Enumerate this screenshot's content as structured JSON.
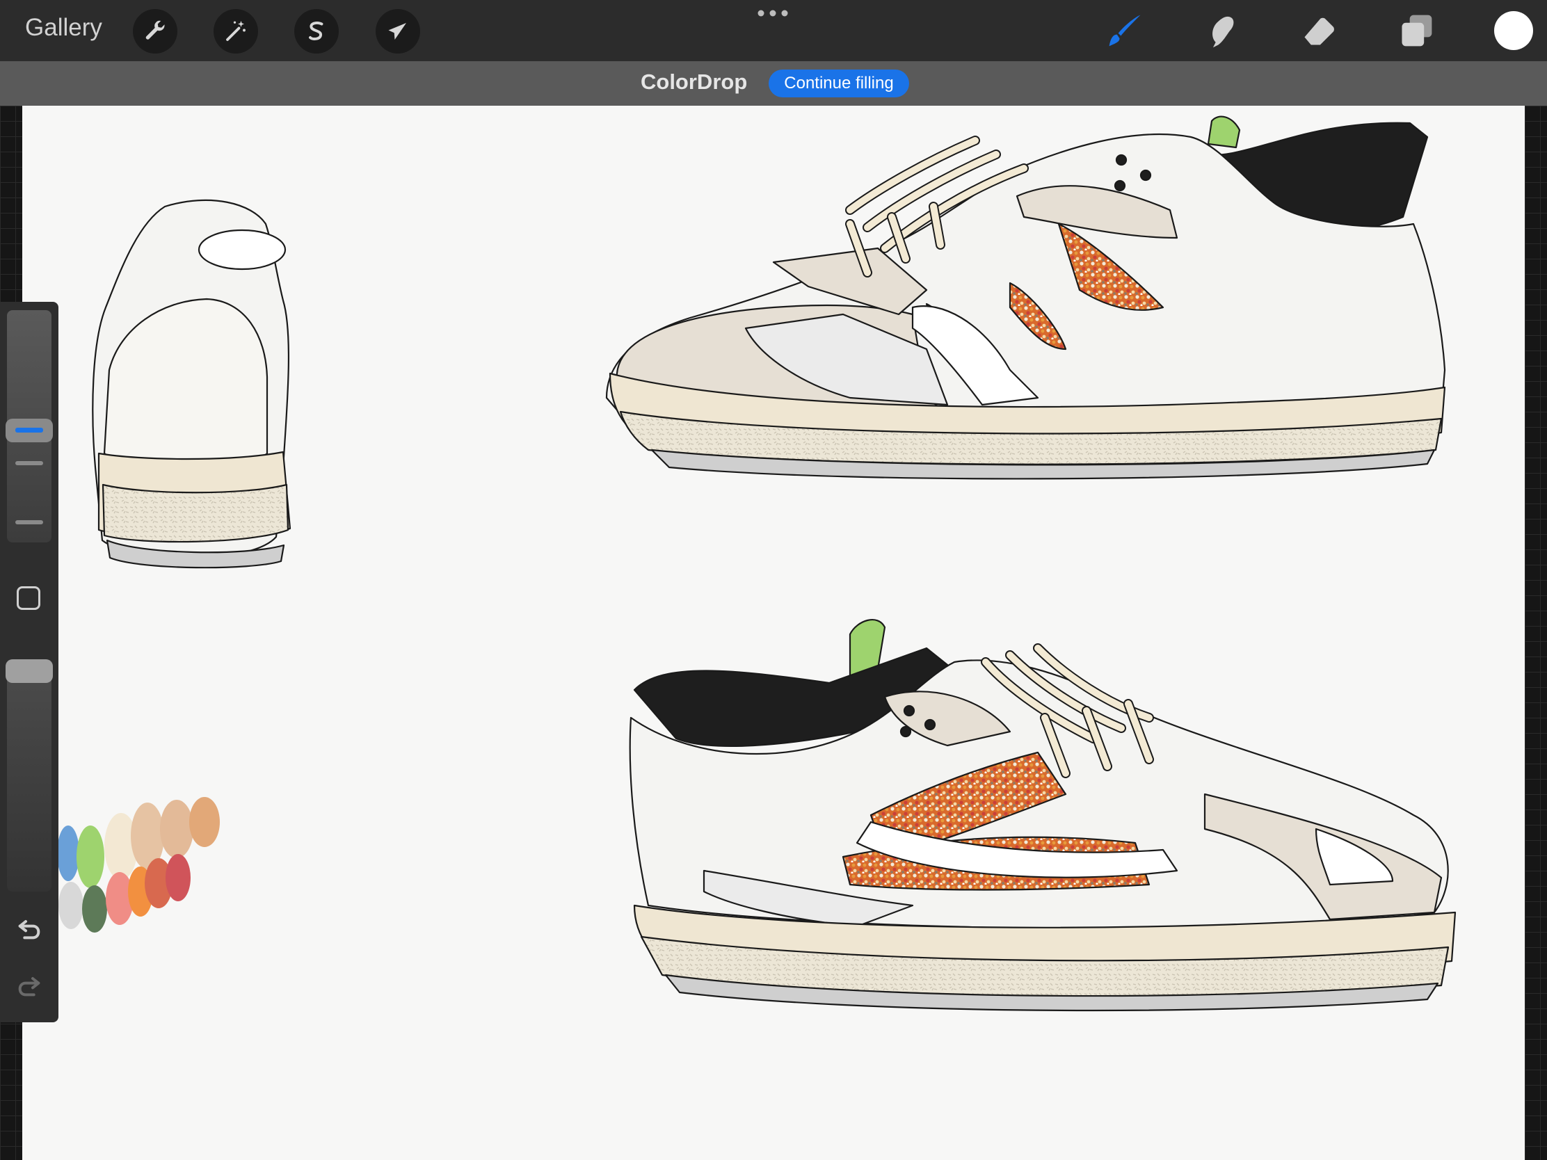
{
  "topbar": {
    "gallery_label": "Gallery",
    "left_tools": [
      {
        "icon": "wrench-icon",
        "name": "actions"
      },
      {
        "icon": "magic-wand-icon",
        "name": "adjustments"
      },
      {
        "icon": "selection-s-icon",
        "name": "selection"
      },
      {
        "icon": "arrow-cursor-icon",
        "name": "transform"
      }
    ],
    "more_icon": "more-dots-icon",
    "right_tools": [
      {
        "icon": "brush-icon",
        "name": "paint",
        "active": true
      },
      {
        "icon": "smudge-icon",
        "name": "smudge"
      },
      {
        "icon": "eraser-icon",
        "name": "eraser"
      },
      {
        "icon": "layers-icon",
        "name": "layers"
      }
    ],
    "current_color": "#ffffff"
  },
  "subbar": {
    "title": "ColorDrop",
    "continue_label": "Continue filling"
  },
  "sidebar": {
    "size_level": 0.38,
    "opacity_level": 1.0,
    "modify_icon": "square-modify-icon",
    "undo_icon": "undo-icon",
    "redo_icon": "redo-icon"
  },
  "colors": {
    "accent": "#1a73e8",
    "topbar": "#2c2c2c",
    "subbar": "#5a5a5a",
    "canvas": "#f7f7f6",
    "leather_white": "#f4f4f2",
    "suede_beige": "#e6dfd4",
    "lining_black": "#1e1e1e",
    "collar_green": "#9ed36e",
    "lace_cream": "#f3ead4",
    "sole_cream": "#efe6d2",
    "sole_speckle": "#d8d2c2",
    "outsole_grey": "#cfcfcf"
  },
  "swatches": [
    "#6aa0d8",
    "#9ed36e",
    "#f3e8d3",
    "#e6c3a3",
    "#e3ba98",
    "#e2a878",
    "#d8d8d8",
    "#5d7a58",
    "#f08d86",
    "#f29040",
    "#d8694f",
    "#d0545a"
  ]
}
